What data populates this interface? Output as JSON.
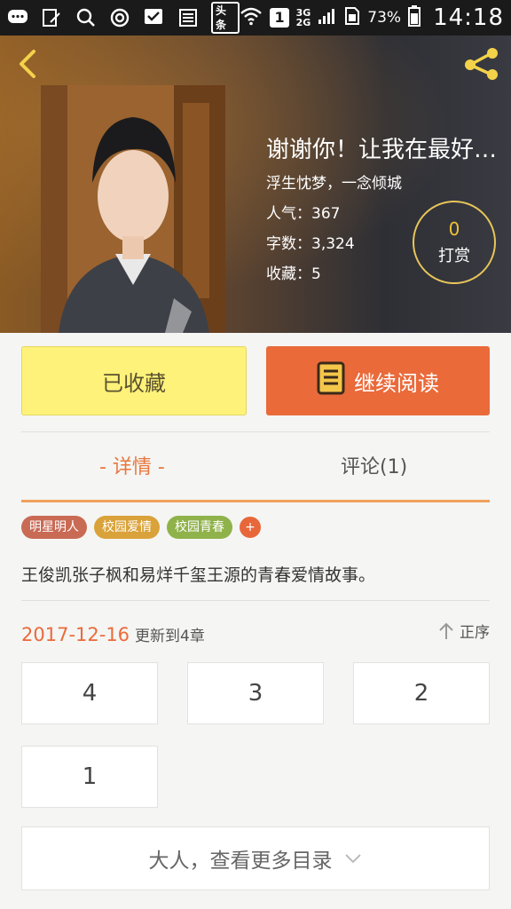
{
  "status_bar": {
    "headline_badge": "头条",
    "sim_slot": "1",
    "network_top": "3G",
    "network_bottom": "2G",
    "battery_percent": "73%",
    "time": "14:18"
  },
  "book": {
    "title": "谢谢你！让我在最好的时光遇见你",
    "author": "浮生忱梦，一念倾城",
    "popularity_label": "人气：",
    "popularity": "367",
    "words_label": "字数：",
    "words": "3,324",
    "favorites_label": "收藏：",
    "favorites": "5",
    "reward_count": "0",
    "reward_label": "打赏"
  },
  "actions": {
    "favorited_label": "已收藏",
    "continue_label": "继续阅读"
  },
  "tabs": {
    "detail": "- 详情 -",
    "comments": "评论(1)"
  },
  "tags": [
    {
      "label": "明星明人",
      "color": "#c96a55"
    },
    {
      "label": "校园爱情",
      "color": "#d9a23a"
    },
    {
      "label": "校园青春",
      "color": "#8fb24a"
    }
  ],
  "tag_more": "+",
  "description": "王俊凯张子枫和易烊千玺王源的青春爱情故事。",
  "update": {
    "date": "2017-12-16",
    "text": "更新到4章",
    "order_label": "正序"
  },
  "chapters": [
    "4",
    "3",
    "2",
    "1"
  ],
  "more_catalog": "大人，查看更多目录",
  "colors": {
    "accent": "#ea6a3a",
    "favorite_bg": "#fff27a",
    "reward_ring": "#e8c65a"
  }
}
